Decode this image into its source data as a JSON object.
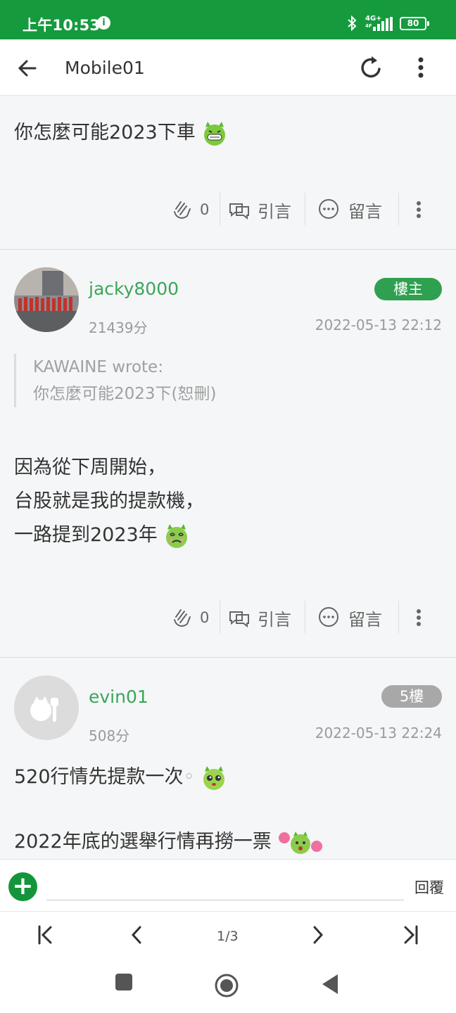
{
  "status": {
    "time": "上午10:53",
    "network": "4G+",
    "network_sub": "4F",
    "battery": "80"
  },
  "appbar": {
    "title": "Mobile01"
  },
  "post1": {
    "text": "你怎麼可能2023下車",
    "like_count": "0",
    "quote_label": "引言",
    "comment_label": "留言"
  },
  "post2": {
    "username": "jacky8000",
    "score": "21439分",
    "badge": "樓主",
    "date": "2022-05-13 22:12",
    "quote_author": "KAWAINE wrote:",
    "quote_text": "你怎麼可能2023下(恕刪)",
    "lines": [
      "因為從下周開始，",
      "台股就是我的提款機，",
      "一路提到2023年"
    ],
    "like_count": "0",
    "quote_label": "引言",
    "comment_label": "留言"
  },
  "post3": {
    "username": "evin01",
    "score": "508分",
    "badge": "5樓",
    "date": "2022-05-13 22:24",
    "line1": "520行情先提款一次",
    "line2": "2022年底的選舉行情再撈一票"
  },
  "reply": {
    "placeholder": "",
    "label": "回覆"
  },
  "pager": {
    "page": "1/3"
  },
  "colors": {
    "brand_green": "#159a3e",
    "username_green": "#3aa65a",
    "badge_owner": "#2fa04f",
    "badge_floor": "#a8a8a8"
  }
}
